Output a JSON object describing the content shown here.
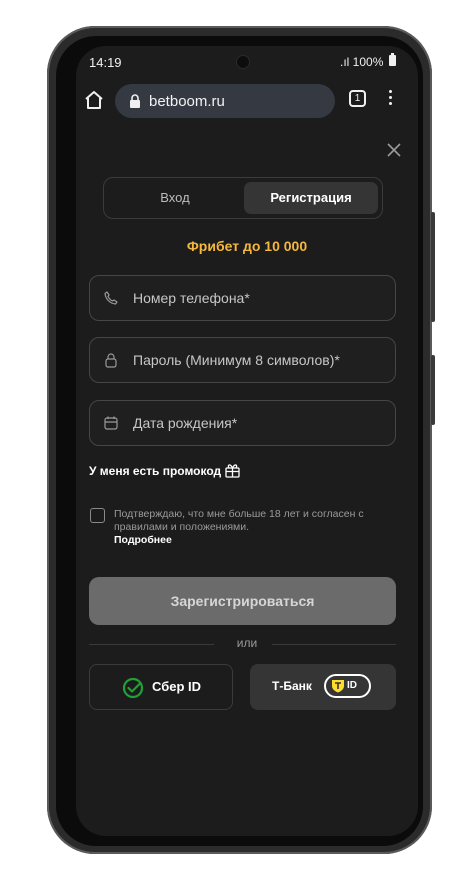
{
  "status_bar": {
    "time": "14:19",
    "signal_battery": ".ıl 100%"
  },
  "browser": {
    "url": "betboom.ru",
    "tab_count": "1"
  },
  "tabs": {
    "login": "Вход",
    "register": "Регистрация",
    "active": "register"
  },
  "promo_title": "Фрибет до 10 000",
  "fields": {
    "phone": "Номер телефона*",
    "password": "Пароль (Минимум 8 символов)*",
    "birthdate": "Дата рождения*"
  },
  "promo_code_label": "У меня есть промокод",
  "consent": {
    "text": "Подтверждаю, что мне больше 18 лет и согласен с правилами и положениями.",
    "link": "Подробнее",
    "checked": false
  },
  "register_button": "Зарегистрироваться",
  "divider_text": "или",
  "sber_button": "Сбер ID",
  "tbank_button": {
    "label": "Т-Банк",
    "badge": "ID"
  },
  "colors": {
    "accent": "#f6b73c",
    "sber_green": "#21a038",
    "tbank_yellow": "#ffdd2d",
    "background": "#1c1c1c"
  },
  "icons": [
    "home-icon",
    "lock-icon",
    "tabs-icon",
    "menu-icon",
    "close-icon",
    "phone-icon",
    "padlock-icon",
    "calendar-icon",
    "gift-icon",
    "sber-logo-icon",
    "tbank-shield-icon"
  ]
}
